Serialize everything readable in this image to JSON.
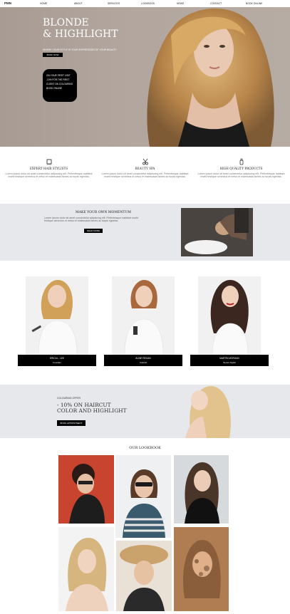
{
  "nav": {
    "brand": "PMN",
    "items": [
      "HOME",
      "ABOUT",
      "SERVICES",
      "LOOKBOOK",
      "NEWS",
      "CONTACT"
    ],
    "cta": "BOOK ONLINE"
  },
  "hero": {
    "title_line1": "BLONDE",
    "title_line2": "& HIGHLIGHT",
    "subtitle": "WHERE YOUR STYLE IS YOUR EXPRESSION OF YOUR BEAUTY",
    "button": "BOOK NOW",
    "promo_line1": "ON YOUR FIRST VISIT",
    "promo_line2": "-10% FOR THE FIRST",
    "promo_line3": "CLIENT ON COLOURING",
    "promo_line4": "BOOK ONLINE"
  },
  "features": [
    {
      "icon": "comb-icon",
      "title": "EXPERT HAIR STYLISTS",
      "text": "Lorem ipsum dolor sit amet consectetur adipiscing elit. Pellentesque habitant morbi tristique senectus et netus et malesuada fames ac turpis egestas."
    },
    {
      "icon": "scissors-icon",
      "title": "BEAUTY SPA",
      "text": "Lorem ipsum dolor sit amet consectetur adipiscing elit. Pellentesque habitant morbi tristique senectus et netus et malesuada fames ac turpis egestas."
    },
    {
      "icon": "bottle-icon",
      "title": "HIGH QUALITY PRODUCTS",
      "text": "Lorem ipsum dolor sit amet consectetur adipiscing elit. Pellentesque habitant morbi tristique senectus et netus et malesuada fames ac turpis egestas."
    }
  ],
  "momentum": {
    "title": "MAKE YOUR OWN MOMENTUM",
    "text": "Lorem ipsum dolor sit amet consectetur adipiscing elit. Pellentesque habitant morbi tristique senectus et netus et malesuada fames ac turpis egestas.",
    "button": "READ MORE"
  },
  "team": [
    {
      "name": "ERICA L. LEE",
      "role": "Founder"
    },
    {
      "name": "ALINE REGAN",
      "role": "Colorist"
    },
    {
      "name": "MARTIN MORGAN",
      "role": "Senior Stylist"
    }
  ],
  "offer": {
    "eyebrow": "COLOURING OFFER",
    "line1": "- 10% ON HAIRCUT",
    "line2": "COLOR AND HIGHLIGHT",
    "button": "BOOK APPOINTMENT"
  },
  "lookbook": {
    "title": "OUR LOOKBOOK"
  },
  "colors": {
    "hero_bg": "#ab9f97",
    "band_bg": "#e6e8eb",
    "black": "#000000"
  }
}
